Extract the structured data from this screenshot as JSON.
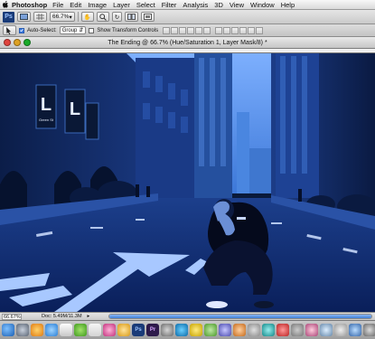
{
  "menubar": {
    "app_name": "Photoshop",
    "items": [
      "File",
      "Edit",
      "Image",
      "Layer",
      "Select",
      "Filter",
      "Analysis",
      "3D",
      "View",
      "Window",
      "Help"
    ]
  },
  "app_toolbar": {
    "logo": "Ps",
    "zoom_value": "66.7%"
  },
  "options_bar": {
    "auto_select_label": "Auto-Select:",
    "auto_select_checked": true,
    "auto_select_target": "Group",
    "show_transform_label": "Show Transform Controls",
    "show_transform_checked": false
  },
  "document": {
    "title": "The Ending @ 66.7% (Hue/Saturation 1, Layer Mask/8) *"
  },
  "canvas": {
    "sign_text_left": "L",
    "sign_text_right": "L",
    "sign_caption": "Green St"
  },
  "status": {
    "zoom": "66.67%",
    "doc_info": "Doc: 5.49M/11.3M"
  },
  "colors": {
    "tint": "#1f4fa8",
    "accent": "#3a7be0"
  }
}
